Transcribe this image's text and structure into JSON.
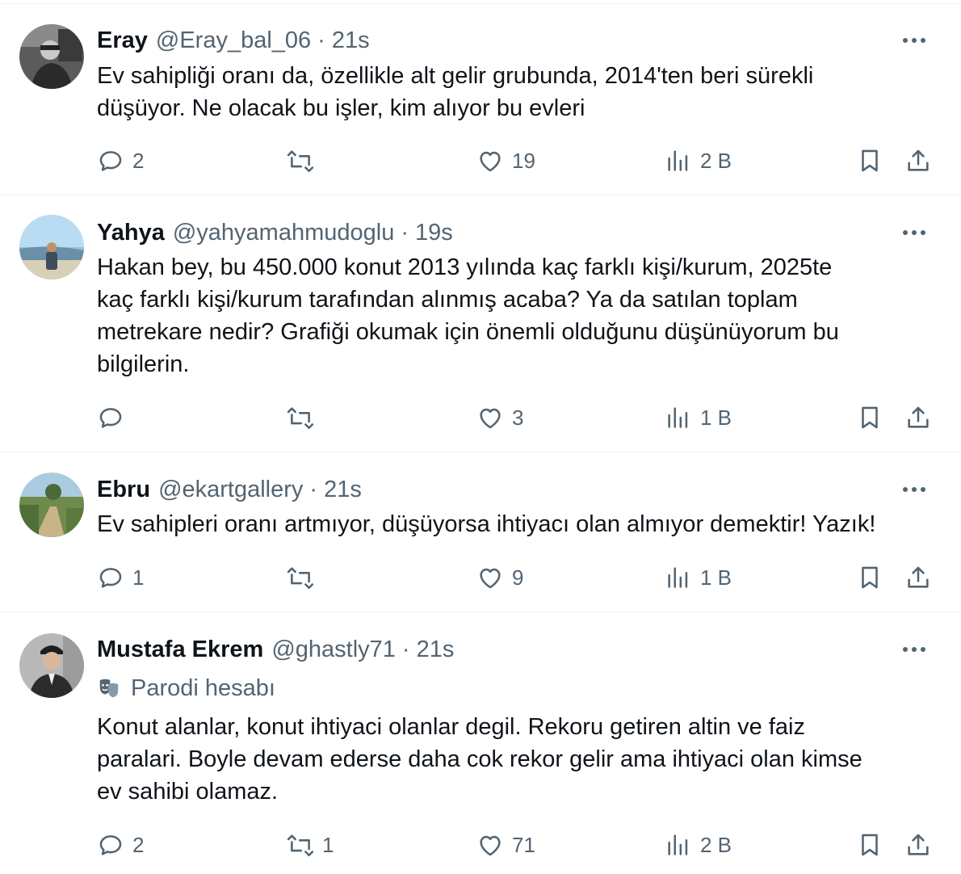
{
  "posts": [
    {
      "name": "Eray",
      "handle": "@Eray_bal_06",
      "time": "21s",
      "text": "Ev sahipliği oranı da, özellikle alt gelir grubunda, 2014'ten beri sürekli\ndüşüyor. Ne olacak bu işler, kim alıyor bu evleri",
      "replies": "2",
      "reposts": "",
      "likes": "19",
      "views": "2 B"
    },
    {
      "name": "Yahya",
      "handle": "@yahyamahmudoglu",
      "time": "19s",
      "text": "Hakan bey, bu 450.000 konut 2013 yılında kaç farklı kişi/kurum, 2025te\nkaç farklı kişi/kurum tarafından alınmış acaba? Ya da satılan toplam\nmetrekare nedir? Grafiği okumak için önemli olduğunu düşünüyorum bu\nbilgilerin.",
      "replies": "",
      "reposts": "",
      "likes": "3",
      "views": "1 B"
    },
    {
      "name": "Ebru",
      "handle": "@ekartgallery",
      "time": "21s",
      "text": "Ev sahipleri oranı artmıyor, düşüyorsa ihtiyacı olan almıyor demektir! Yazık!",
      "replies": "1",
      "reposts": "",
      "likes": "9",
      "views": "1 B"
    },
    {
      "name": "Mustafa Ekrem",
      "handle": "@ghastly71",
      "time": "21s",
      "badge": "Parodi hesabı",
      "text": "Konut alanlar, konut ihtiyaci olanlar degil. Rekoru getiren altin ve faiz\nparalari. Boyle devam ederse daha cok rekor gelir ama ihtiyaci olan kimse\nev sahibi olamaz.",
      "replies": "2",
      "reposts": "1",
      "likes": "71",
      "views": "2 B"
    }
  ],
  "separator": "·",
  "colors": {
    "text": "#0f1419",
    "secondary": "#536471",
    "border": "#eff3f4"
  },
  "icons": [
    "more-icon",
    "reply-icon",
    "repost-icon",
    "like-icon",
    "views-icon",
    "bookmark-icon",
    "share-icon",
    "parody-mask-icon"
  ]
}
